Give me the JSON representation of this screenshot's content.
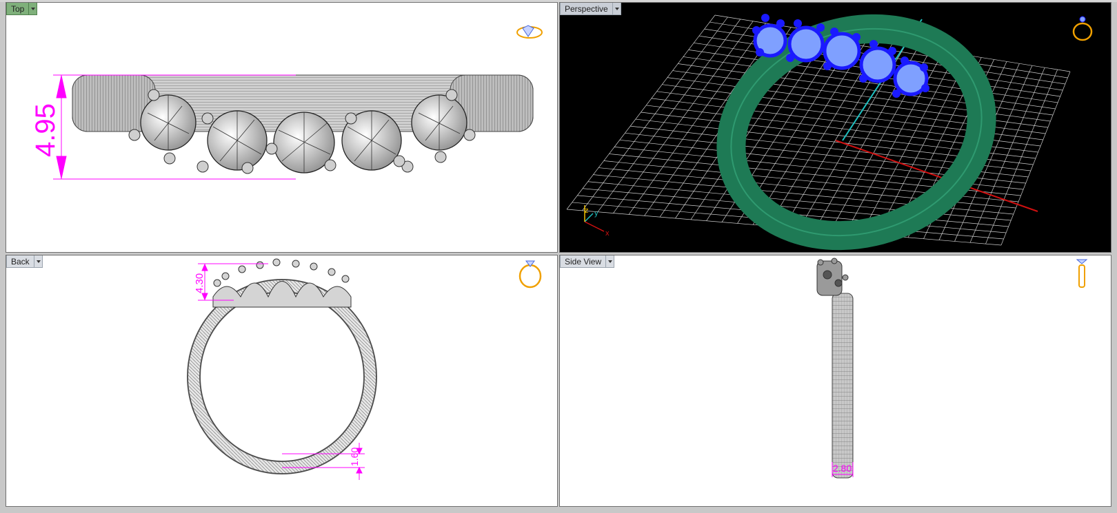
{
  "viewports": {
    "top": {
      "label": "Top",
      "dimension": "4.95"
    },
    "perspective": {
      "label": "Perspective",
      "axes": {
        "z": "z",
        "y": "y",
        "x": "x"
      }
    },
    "back": {
      "label": "Back",
      "dimension_height": "4.30",
      "dimension_band": "1.60"
    },
    "side": {
      "label": "Side View",
      "dimension_width": "2.80"
    }
  },
  "icons": {
    "top_gizmo": "ring-diamond-top-icon",
    "perspective_gizmo": "ring-perspective-icon",
    "back_gizmo": "ring-front-icon",
    "side_gizmo": "ring-side-icon"
  },
  "colors": {
    "active_label": "#7fb07b",
    "dimension": "#ff00ff",
    "stones": "#1a1aff",
    "band": "#1e7a55",
    "grid": "#cfcfcf",
    "axis_x": "#d01010",
    "axis_y": "#20c0c0"
  }
}
